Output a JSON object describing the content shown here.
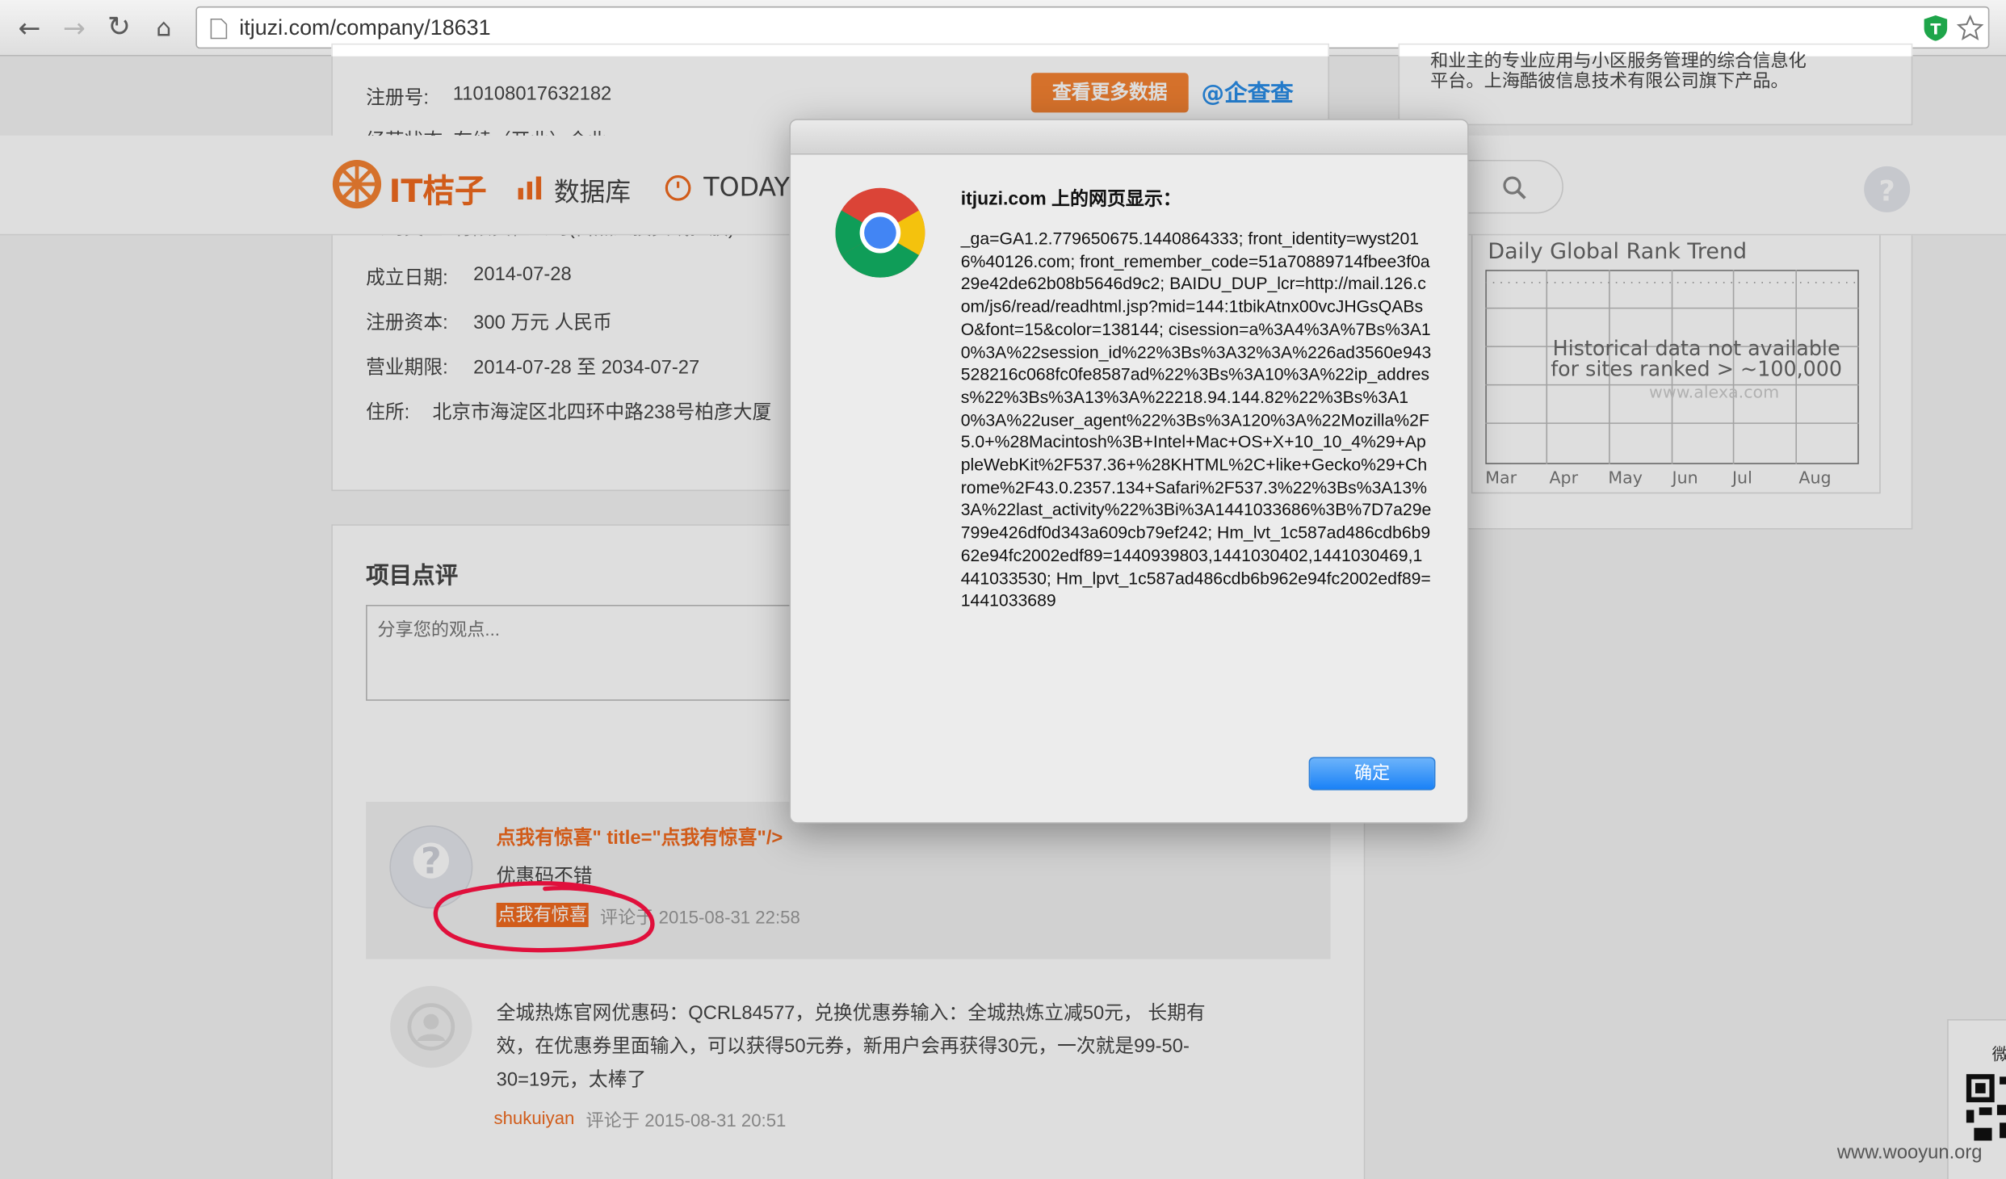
{
  "browser": {
    "url": "itjuzi.com/company/18631",
    "back_icon": "arrow-left-icon",
    "forward_icon": "arrow-right-icon",
    "reload_icon": "reload-icon",
    "home_icon": "home-icon"
  },
  "company": {
    "reg_label": "注册号:",
    "reg_value": "110108017632182",
    "status_partial": "经营状态:   存续（开业）企业",
    "type_partial": "公司类型: 有限责任公司(自然人投资或控股)",
    "found_label": "成立日期:",
    "found_value": "2014-07-28",
    "capital_label": "注册资本:",
    "capital_value": "300 万元 人民币",
    "term_label": "营业期限:",
    "term_value": "2014-07-28 至 2034-07-27",
    "addr_label": "住所:",
    "addr_value": "北京市海淀区北四环中路238号柏彦大厦",
    "more_button": "查看更多数据",
    "qichacha_link": "@企查查"
  },
  "sidebar": {
    "desc_line1": "和业主的专业应用与小区服务管理的综合信息化",
    "desc_line2": "平台。上海酷彼信息技术有限公司旗下产品。",
    "chart_title": "Daily Global Rank Trend",
    "overlay_line1": "Historical data not available",
    "overlay_line2": "for sites ranked > ~100,000",
    "watermark": "www.alexa.com",
    "months": [
      "Mar",
      "Apr",
      "May",
      "Jun",
      "Jul",
      "Aug"
    ],
    "wechat": "微"
  },
  "nav": {
    "logo_text": "IT桔子",
    "database": "数据库",
    "today": "TODAY"
  },
  "review": {
    "title": "项目点评",
    "placeholder": "分享您的观点..."
  },
  "comments": [
    {
      "xss_text": "点我有惊喜\" title=\"点我有惊喜\"/>",
      "body": "优惠码不错",
      "author": "点我有惊喜",
      "meta": "评论于 2015-08-31 22:58"
    },
    {
      "body_lines": [
        "全城热炼官网优惠码：QCRL84577，兑换优惠券输入：全城热炼立减50元，  长期有",
        "效，在优惠券里面输入，可以获得50元券，新用户会再获得30元，一次就是99-50-",
        "30=19元，太棒了"
      ],
      "author": "shukuiyan",
      "meta": "评论于 2015-08-31 20:51"
    }
  ],
  "dialog": {
    "title": "itjuzi.com 上的网页显示：",
    "message": "_ga=GA1.2.779650675.1440864333; front_identity=wyst2016%40126.com; front_remember_code=51a70889714fbee3f0a29e42de62b08b5646d9c2; BAIDU_DUP_lcr=http://mail.126.com/js6/read/readhtml.jsp?mid=144:1tbikAtnx00vcJHGsQABsO&font=15&color=138144; cisession=a%3A4%3A%7Bs%3A10%3A%22session_id%22%3Bs%3A32%3A%226ad3560e943528216c068fc0fe8587ad%22%3Bs%3A10%3A%22ip_address%22%3Bs%3A13%3A%22218.94.144.82%22%3Bs%3A10%3A%22user_agent%22%3Bs%3A120%3A%22Mozilla%2F5.0+%28Macintosh%3B+Intel+Mac+OS+X+10_10_4%29+AppleWebKit%2F537.36+%28KHTML%2C+like+Gecko%29+Chrome%2F43.0.2357.134+Safari%2F537.3%22%3Bs%3A13%3A%22last_activity%22%3Bi%3A1441033686%3B%7D7a29e799e426df0d343a609cb79ef242; Hm_lvt_1c587ad486cdb6b962e94fc2002edf89=1440939803,1441030402,1441030469,1441033530; Hm_lpvt_1c587ad486cdb6b962e94fc2002edf89=1441033689",
    "ok": "确定"
  },
  "footer": {
    "watermark": "www.wooyun.org"
  },
  "colors": {
    "brand_orange": "#f06a1e",
    "ok_blue": "#1a82f7",
    "annotation_red": "#e0103c"
  }
}
